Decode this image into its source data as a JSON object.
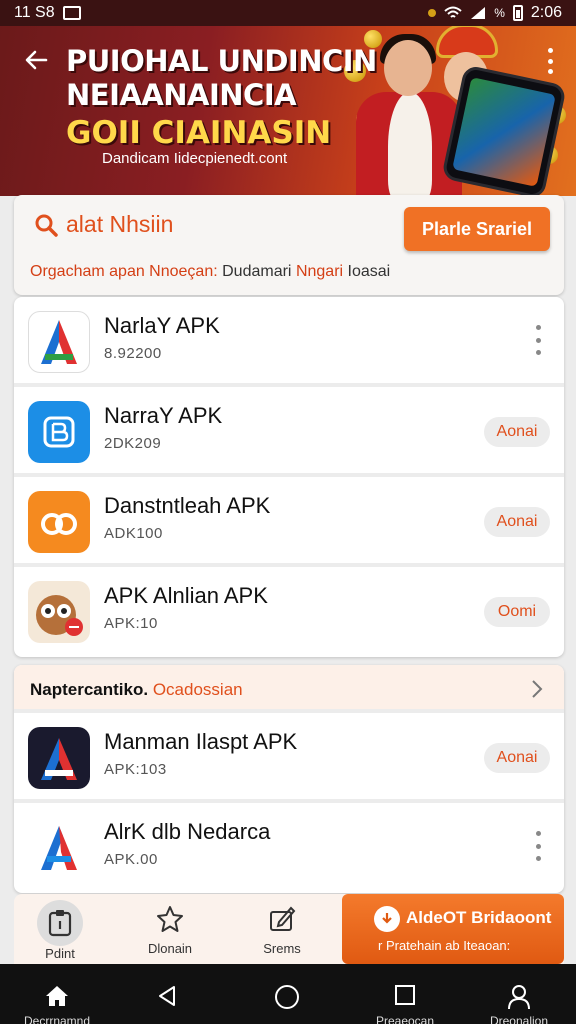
{
  "status_bar": {
    "left_text": "11 S8",
    "right_text": "2:06",
    "battery_text": "%"
  },
  "banner": {
    "title_line1": "PUIOHAL UNDINCIN",
    "title_line2": "NEIAANAINCIA",
    "title_line3": "GOII CIAINASIN",
    "url": "Dandicam Iidecpienedt.cont"
  },
  "search": {
    "label": "alat Nhsiin",
    "button_label": "Plarle Srariel",
    "hint_part1": "Orgacham apan Nnoeçan:",
    "hint_part2": "Dudamari",
    "hint_part3": "Nngari",
    "hint_part4": "Ioasai"
  },
  "apps_top": [
    {
      "name": "NarlaY APK",
      "meta": "8.92200",
      "action": "kebab",
      "icon": "letter-a-icon",
      "color": "#ffffff"
    },
    {
      "name": "NarraY APK",
      "meta": "2DK209",
      "action": "pill",
      "action_label": "Aonai",
      "icon": "square-b-icon",
      "color": "#1c8ee6"
    },
    {
      "name": "Danstntleah APK",
      "meta": "ADK100",
      "action": "pill",
      "action_label": "Aonai",
      "icon": "orange-logo-icon",
      "color": "#f58a1f"
    },
    {
      "name": "APK Alnlian APK",
      "meta": "APK:10",
      "action": "pill",
      "action_label": "Oomi",
      "icon": "owl-icon",
      "color": "#f4e8d8"
    }
  ],
  "section": {
    "title_part1": "Naptercantiko.",
    "title_part2": "Ocadossian"
  },
  "apps_bottom": [
    {
      "name": "Manman Ilaspt APK",
      "meta": "APK:103",
      "action": "pill",
      "action_label": "Aonai",
      "icon": "dark-a-icon",
      "color": "#1a1a2e"
    },
    {
      "name": "AlrK dlb Nedarca",
      "meta": "APK.00",
      "action": "kebab",
      "icon": "blue-red-a-icon",
      "color": "#ffffff"
    }
  ],
  "bottom_bar": {
    "tab1_label": "Pdint",
    "tab2_label": "Dlonain",
    "tab3_label": "Srems",
    "cta_title": "AldeOT Bridaoont",
    "cta_sub": "r Pratehain ab Iteaoan:"
  },
  "nav": {
    "home_label": "Decrrnamnd",
    "recents_label": "Preaeocan",
    "profile_label": "Dreonalion"
  },
  "colors": {
    "accent": "#f07125",
    "banner_dark": "#6b1a1a",
    "text_orange": "#e0501d"
  }
}
